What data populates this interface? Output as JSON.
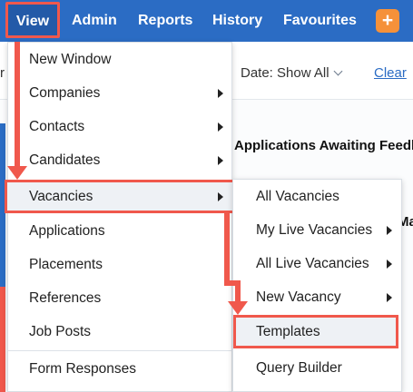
{
  "nav": {
    "view": "View",
    "admin": "Admin",
    "reports": "Reports",
    "history": "History",
    "favourites": "Favourites",
    "plus": "+"
  },
  "background": {
    "partial_letter": "r",
    "date_filter": "Date: Show All",
    "clear_link": "Clear",
    "panel_heading": "Applications Awaiting Feedb",
    "panel_heading2": "Ma"
  },
  "menu": {
    "items": [
      {
        "label": "New Window",
        "submenu": false
      },
      {
        "label": "Companies",
        "submenu": true
      },
      {
        "label": "Contacts",
        "submenu": true
      },
      {
        "label": "Candidates",
        "submenu": true
      },
      {
        "label": "Vacancies",
        "submenu": true
      },
      {
        "label": "Applications",
        "submenu": false
      },
      {
        "label": "Placements",
        "submenu": false
      },
      {
        "label": "References",
        "submenu": false
      },
      {
        "label": "Job Posts",
        "submenu": false
      },
      {
        "label": "Form Responses",
        "submenu": false
      }
    ]
  },
  "submenu": {
    "items": [
      {
        "label": "All Vacancies",
        "submenu": false
      },
      {
        "label": "My Live Vacancies",
        "submenu": true
      },
      {
        "label": "All Live Vacancies",
        "submenu": true
      },
      {
        "label": "New Vacancy",
        "submenu": true
      },
      {
        "label": "Templates",
        "submenu": false
      },
      {
        "label": "Query Builder",
        "submenu": false
      }
    ]
  },
  "colors": {
    "nav_bg": "#2b6cc4",
    "highlight": "#f0584c",
    "plus_button": "#f5913a",
    "link": "#2b6cc4"
  }
}
